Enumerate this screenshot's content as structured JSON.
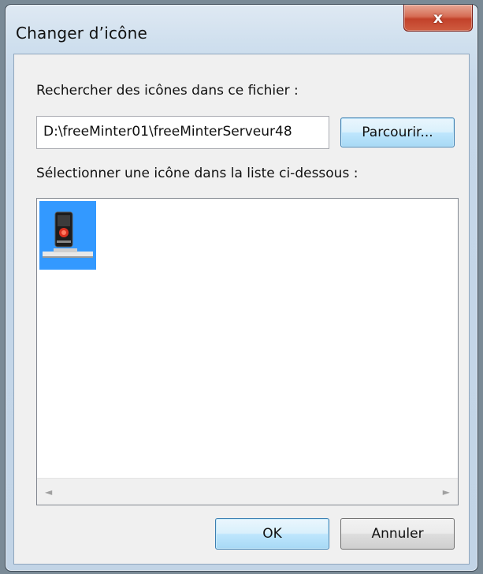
{
  "window": {
    "title": "Changer d’icône",
    "close_label": "x"
  },
  "file_section": {
    "label": "Rechercher des icônes dans ce fichier :",
    "path_value": "D:\\freeMinter01\\freeMinterServeur48",
    "browse_label": "Parcourir..."
  },
  "list_section": {
    "label": "Sélectionner une icône dans la liste ci-dessous :",
    "icons": [
      {
        "icon": "server-device-icon",
        "selected": true
      }
    ],
    "scroll_left": "◄",
    "scroll_right": "►"
  },
  "buttons": {
    "ok_label": "OK",
    "cancel_label": "Annuler"
  },
  "colors": {
    "selection": "#3399ff",
    "close_button": "#c2412a",
    "focus_border": "#3c7fb1"
  }
}
